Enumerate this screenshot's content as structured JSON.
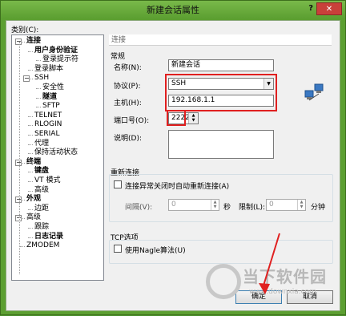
{
  "window": {
    "title": "新建会话属性",
    "help_label": "?",
    "close_label": "✕"
  },
  "category": {
    "label": "类别(C):",
    "tree": [
      {
        "label": "连接",
        "bold": true
      },
      {
        "label": "用户身份验证",
        "bold": true
      },
      {
        "label": "登录提示符",
        "bold": false
      },
      {
        "label": "登录脚本",
        "bold": false
      },
      {
        "label": "SSH",
        "bold": false
      },
      {
        "label": "安全性",
        "bold": false
      },
      {
        "label": "隧道",
        "bold": true
      },
      {
        "label": "SFTP",
        "bold": false
      },
      {
        "label": "TELNET",
        "bold": false
      },
      {
        "label": "RLOGIN",
        "bold": false
      },
      {
        "label": "SERIAL",
        "bold": false
      },
      {
        "label": "代理",
        "bold": false
      },
      {
        "label": "保持活动状态",
        "bold": false
      },
      {
        "label": "终端",
        "bold": true
      },
      {
        "label": "键盘",
        "bold": true
      },
      {
        "label": "VT 模式",
        "bold": false
      },
      {
        "label": "高级",
        "bold": false
      },
      {
        "label": "外观",
        "bold": true
      },
      {
        "label": "边距",
        "bold": false
      },
      {
        "label": "高级",
        "bold": false
      },
      {
        "label": "跟踪",
        "bold": false
      },
      {
        "label": "日志记录",
        "bold": true
      },
      {
        "label": "ZMODEM",
        "bold": false
      }
    ]
  },
  "panel": {
    "header": "连接",
    "general": {
      "title": "常规",
      "name_label": "名称(N):",
      "name_value": "新建会话",
      "protocol_label": "协议(P):",
      "protocol_value": "SSH",
      "host_label": "主机(H):",
      "host_value": "192.168.1.1",
      "port_label": "端口号(O):",
      "port_value": "2222",
      "desc_label": "说明(D):",
      "desc_value": ""
    },
    "reconnect": {
      "title": "重新连接",
      "checkbox_label": "连接异常关闭时自动重新连接(A)",
      "interval_label": "间隔(V):",
      "interval_value": "0",
      "interval_unit": "秒",
      "limit_label": "限制(L):",
      "limit_value": "0",
      "limit_unit": "分钟"
    },
    "tcp": {
      "title": "TCP选项",
      "nagle_label": "使用Nagle算法(U)"
    }
  },
  "buttons": {
    "ok": "确定",
    "cancel": "取消"
  },
  "watermark": {
    "name": "当下软件园",
    "url": "www.downxia.com"
  },
  "colors": {
    "highlight": "#e02020",
    "title_bar": "#5c9f31"
  }
}
